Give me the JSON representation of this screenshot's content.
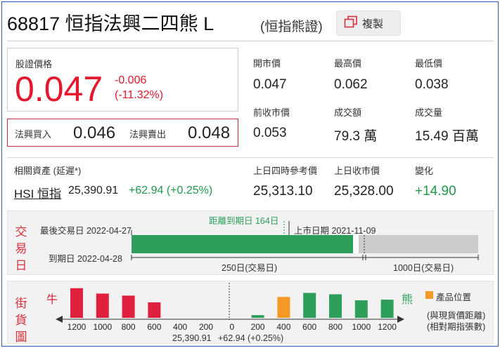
{
  "header": {
    "title": "68817 恒指法興二四熊 L",
    "subtitle": "(恒指熊證)",
    "copy_label": "複製"
  },
  "price": {
    "label": "股證價格",
    "value": "0.047",
    "change": "-0.006",
    "change_pct": "(-11.32%)"
  },
  "quote": {
    "bid_label": "法興買入",
    "bid_value": "0.046",
    "ask_label": "法興賣出",
    "ask_value": "0.048"
  },
  "stats": {
    "open_label": "開市價",
    "open_value": "0.047",
    "high_label": "最高價",
    "high_value": "0.062",
    "low_label": "最低價",
    "low_value": "0.038",
    "prev_close_label": "前收市價",
    "prev_close_value": "0.053",
    "turnover_label": "成交額",
    "turnover_value": "79.3 萬",
    "volume_label": "成交量",
    "volume_value": "15.49 百萬"
  },
  "underlying": {
    "label": "相關資產 (延遲*)",
    "name": "HSI 恒指",
    "price": "25,390.91",
    "change": "+62.94 (+0.25%)",
    "ref_label": "上日四時參考價",
    "ref_value": "25,313.10",
    "prev_close_label": "上日收市價",
    "prev_close_value": "25,328.00",
    "diff_label": "變化",
    "diff_value": "+14.90"
  },
  "timeline": {
    "side_label": [
      "交",
      "易",
      "日"
    ],
    "last_trade": "最後交易日 2022-04-27",
    "expiry": "到期日 2022-04-28",
    "days_to_expiry": "距離到期日 164日",
    "listing": "上市日期 2021-11-09",
    "span_short": "250日(交易日)",
    "span_long": "1000日(交易日)",
    "elapsed_fraction": 0.656,
    "colors": {
      "elapsed": "#2e9e5b",
      "remaining": "#cccccc"
    }
  },
  "street": {
    "side_label": [
      "街",
      "貨",
      "圖"
    ],
    "bull_label": "牛",
    "bear_label": "熊",
    "legend_label": "產品位置",
    "note_line1": "(與現貨價距離)",
    "note_line2": "(相對期指張數)",
    "bottom_price": "25,390.91",
    "bottom_change": "+62.94 (+0.25%)",
    "colors": {
      "bull": "#e0213d",
      "bear": "#2e9e5b",
      "product": "#f39a26"
    }
  },
  "chart_data": {
    "type": "bar",
    "categories": [
      "1200",
      "1000",
      "800",
      "600",
      "400",
      "200",
      "0",
      "200",
      "400",
      "600",
      "800",
      "1000",
      "1200"
    ],
    "series": [
      {
        "name": "牛",
        "values": [
          44,
          36,
          33,
          23,
          0,
          0,
          0,
          0,
          0,
          0,
          0,
          0,
          0
        ]
      },
      {
        "name": "熊",
        "values": [
          0,
          0,
          0,
          0,
          0,
          0,
          0,
          4,
          0,
          37,
          35,
          26,
          27
        ]
      },
      {
        "name": "產品位置",
        "values": [
          0,
          0,
          0,
          0,
          0,
          0,
          0,
          0,
          31,
          0,
          0,
          0,
          0
        ]
      }
    ],
    "ylim": [
      0,
      50
    ]
  }
}
